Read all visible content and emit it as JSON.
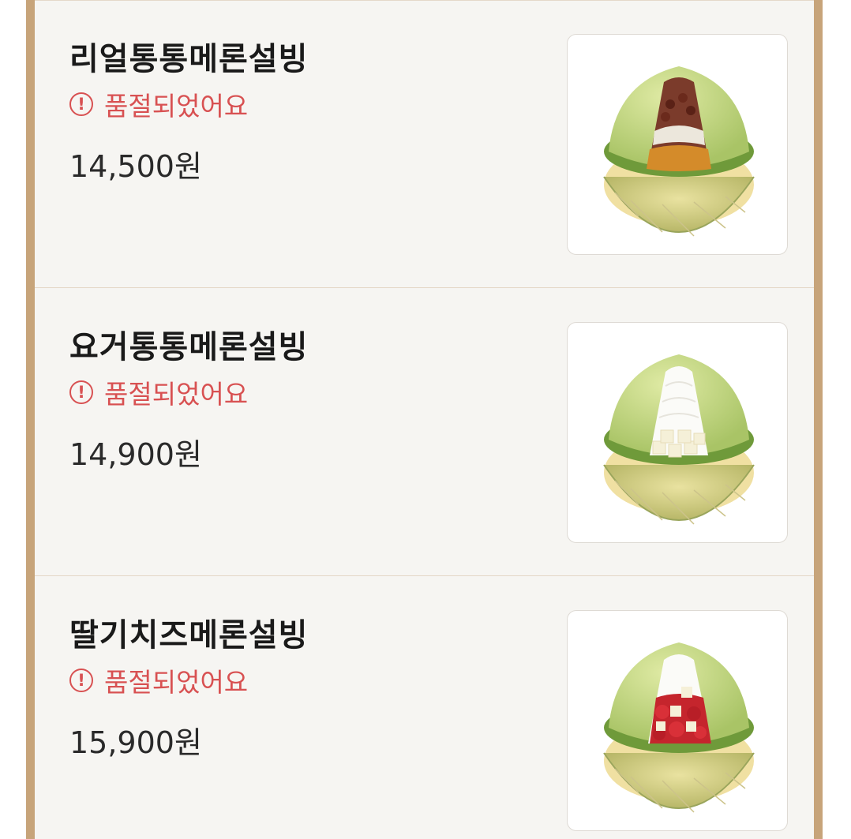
{
  "menu": {
    "status_icon": "exclamation-circle-icon",
    "items": [
      {
        "name": "리얼통통메론설빙",
        "status": "품절되었어요",
        "price": "14,500원",
        "image": "melon-bingsu-red-bean-icon"
      },
      {
        "name": "요거통통메론설빙",
        "status": "품절되었어요",
        "price": "14,900원",
        "image": "melon-bingsu-yogurt-icon"
      },
      {
        "name": "딸기치즈메론설빙",
        "status": "품절되었어요",
        "price": "15,900원",
        "image": "melon-bingsu-strawberry-icon"
      }
    ]
  },
  "colors": {
    "frame_border": "#c7a47a",
    "panel_bg": "#f6f5f2",
    "sold_out": "#d85152",
    "title": "#1a1a1a"
  }
}
